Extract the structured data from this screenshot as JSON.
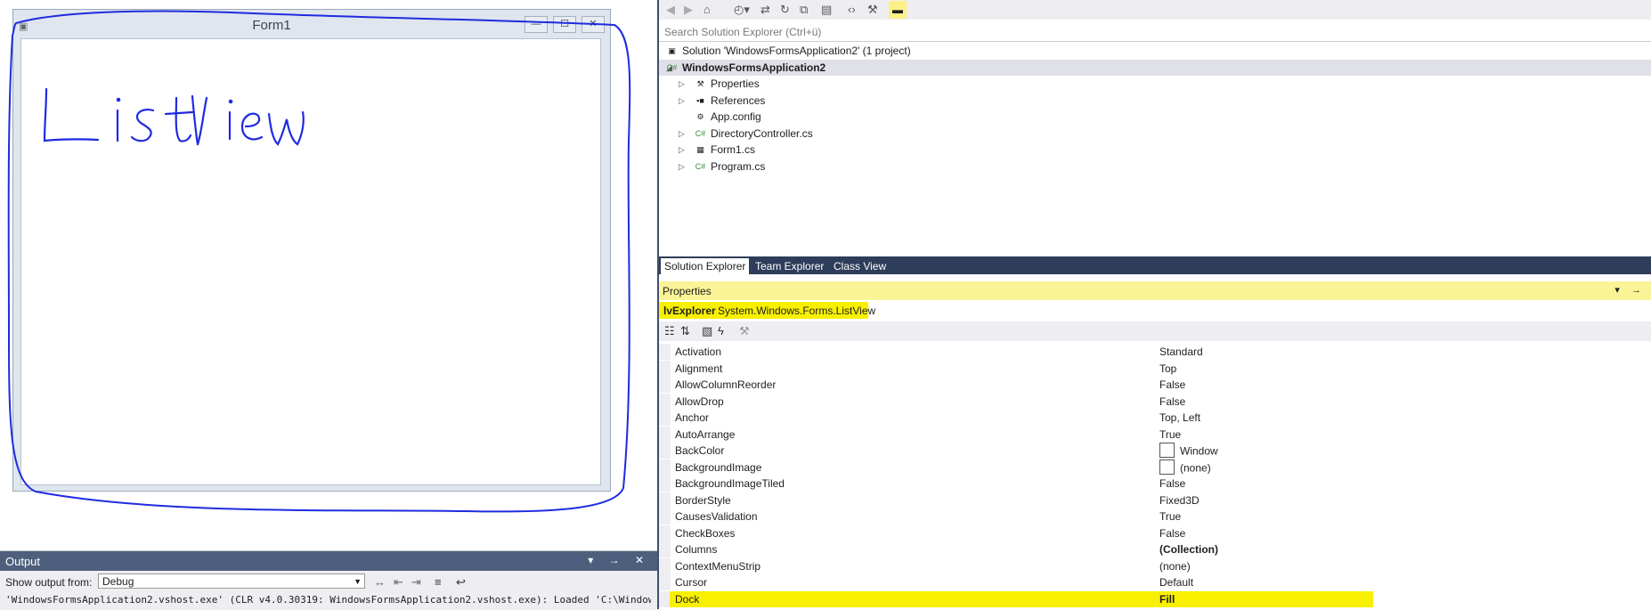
{
  "designer": {
    "form_title": "Form1",
    "caption_buttons": {
      "minimize": "—",
      "maximize": "☐",
      "close": "✕"
    },
    "annotation_text": "List View",
    "annotation_color": "#1f2be0"
  },
  "output": {
    "title": "Output",
    "header_icons": "▾ → ✕",
    "show_from_label": "Show output from:",
    "source": "Debug",
    "line": "'WindowsFormsApplication2.vshost.exe' (CLR v4.0.30319: WindowsFormsApplication2.vshost.exe): Loaded 'C:\\Window"
  },
  "solution_explorer": {
    "search_placeholder": "Search Solution Explorer (Ctrl+ü)",
    "tree": [
      {
        "label": "Solution 'WindowsFormsApplication2' (1 project)",
        "icon": "solution-icon",
        "indent": 1,
        "arrow": ""
      },
      {
        "label": "WindowsFormsApplication2",
        "icon": "csharp-project-icon",
        "indent": 1,
        "arrow": "◢"
      },
      {
        "label": "Properties",
        "icon": "wrench-icon",
        "indent": 2,
        "arrow": "▷"
      },
      {
        "label": "References",
        "icon": "references-icon",
        "indent": 2,
        "arrow": "▷"
      },
      {
        "label": "App.config",
        "icon": "config-file-icon",
        "indent": 2,
        "arrow": ""
      },
      {
        "label": "DirectoryController.cs",
        "icon": "csharp-file-icon",
        "indent": 2,
        "arrow": "▷"
      },
      {
        "label": "Form1.cs",
        "icon": "form-icon",
        "indent": 2,
        "arrow": "▷"
      },
      {
        "label": "Program.cs",
        "icon": "csharp-file-icon",
        "indent": 2,
        "arrow": "▷"
      }
    ],
    "tabs": [
      "Solution Explorer",
      "Team Explorer",
      "Class View"
    ],
    "active_tab": "Solution Explorer"
  },
  "properties": {
    "title": "Properties",
    "header_icons": "▾ →",
    "object_name": "lvExplorer",
    "object_type": "System.Windows.Forms.ListView",
    "highlight_color": "#f8f000",
    "rows": [
      {
        "name": "Activation",
        "value": "Standard"
      },
      {
        "name": "Alignment",
        "value": "Top"
      },
      {
        "name": "AllowColumnReorder",
        "value": "False"
      },
      {
        "name": "AllowDrop",
        "value": "False"
      },
      {
        "name": "Anchor",
        "value": "Top, Left"
      },
      {
        "name": "AutoArrange",
        "value": "True"
      },
      {
        "name": "BackColor",
        "value": "Window",
        "swatch": true
      },
      {
        "name": "BackgroundImage",
        "value": "(none)",
        "swatch": true
      },
      {
        "name": "BackgroundImageTiled",
        "value": "False"
      },
      {
        "name": "BorderStyle",
        "value": "Fixed3D"
      },
      {
        "name": "CausesValidation",
        "value": "True"
      },
      {
        "name": "CheckBoxes",
        "value": "False"
      },
      {
        "name": "Columns",
        "value": "(Collection)",
        "bold": true
      },
      {
        "name": "ContextMenuStrip",
        "value": "(none)"
      },
      {
        "name": "Cursor",
        "value": "Default"
      },
      {
        "name": "Dock",
        "value": "Fill",
        "bold": true,
        "highlight": true
      }
    ]
  }
}
